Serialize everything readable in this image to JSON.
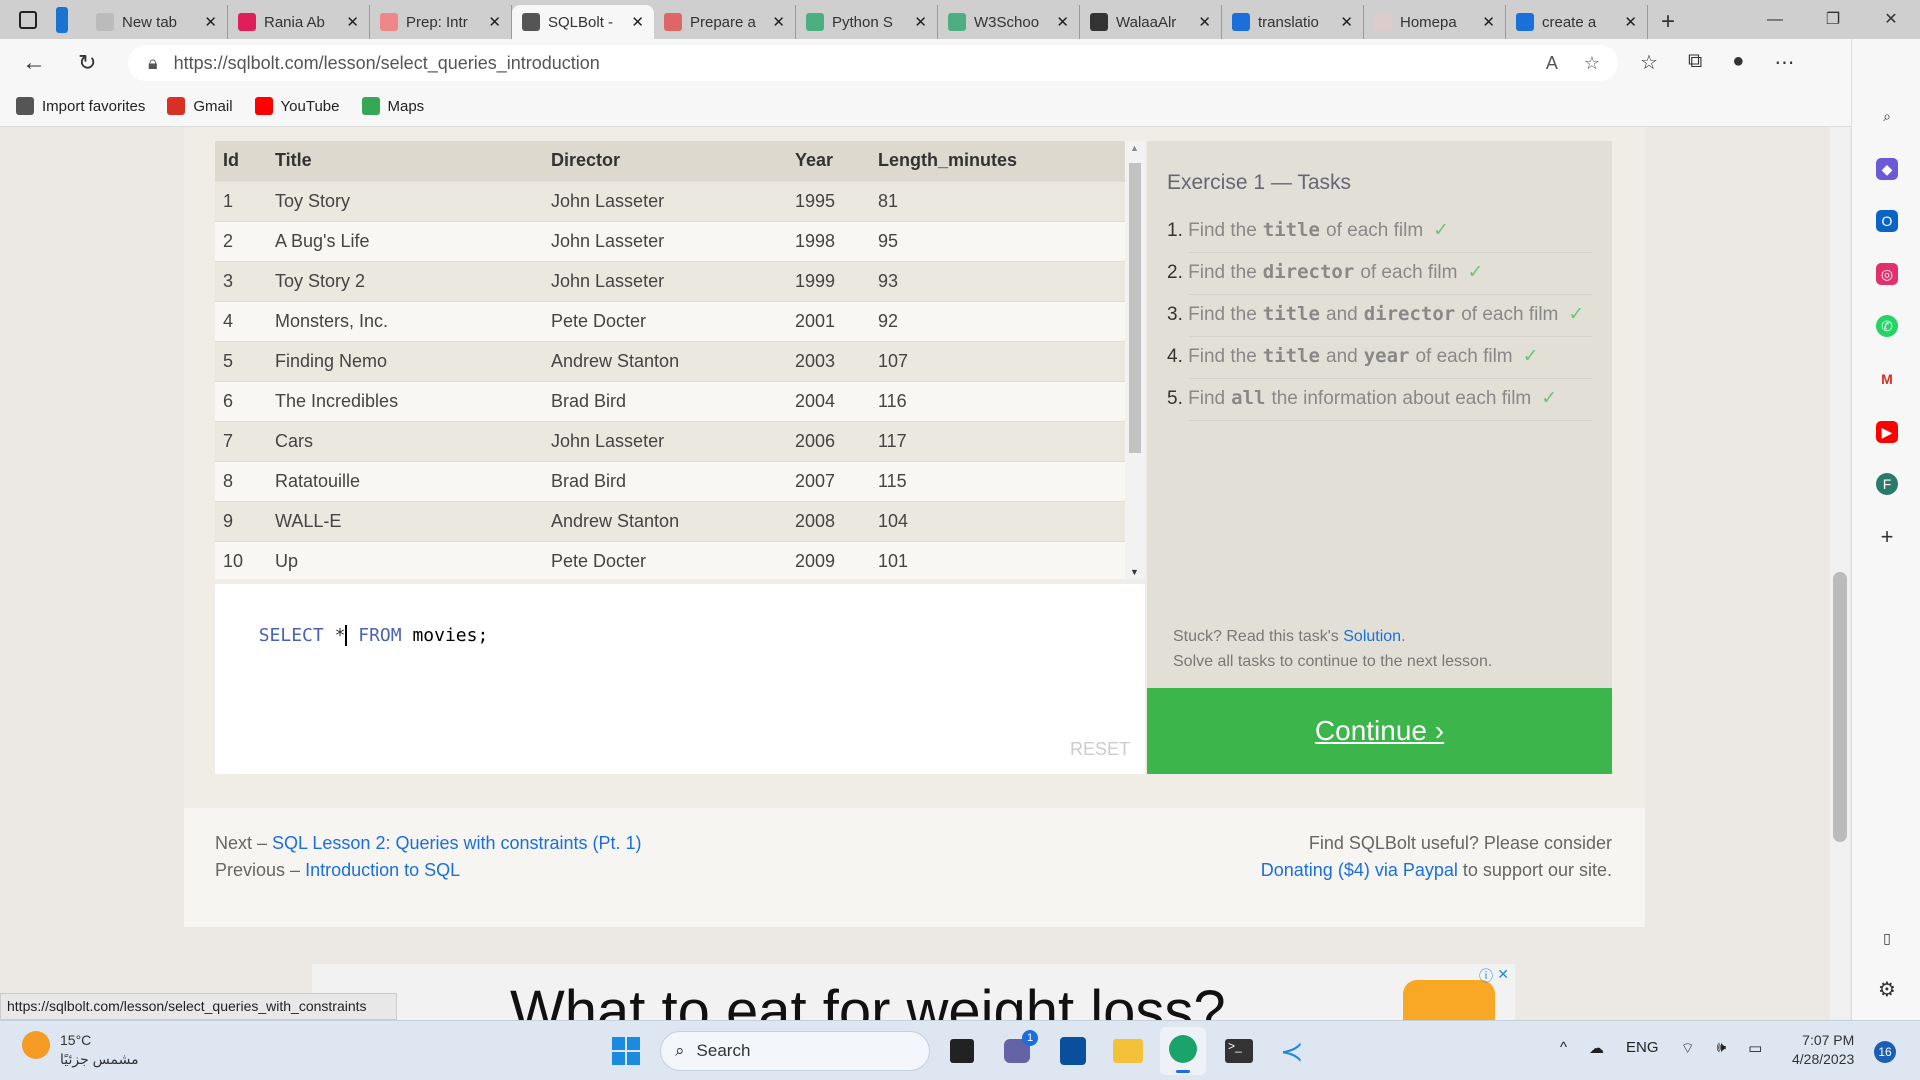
{
  "browser": {
    "tabs": [
      {
        "title": "New tab",
        "icon": "newtab-icon"
      },
      {
        "title": "Rania Ab",
        "icon": "slack-icon"
      },
      {
        "title": "Prep: Intr",
        "icon": "canvas-icon"
      },
      {
        "title": "SQLBolt -",
        "icon": "database-icon",
        "active": true
      },
      {
        "title": "Prepare a",
        "icon": "code-shield-icon"
      },
      {
        "title": "Python S",
        "icon": "w3schools-icon"
      },
      {
        "title": "W3Schoo",
        "icon": "w3schools-icon"
      },
      {
        "title": "WalaaAlr",
        "icon": "github-icon"
      },
      {
        "title": "translatio",
        "icon": "search-icon"
      },
      {
        "title": "Homepa",
        "icon": "ltuc-icon"
      },
      {
        "title": "create a",
        "icon": "search-icon"
      }
    ],
    "url": "https://sqlbolt.com/lesson/select_queries_introduction",
    "favorites": [
      {
        "label": "Import favorites"
      },
      {
        "label": "Gmail"
      },
      {
        "label": "YouTube"
      },
      {
        "label": "Maps"
      }
    ],
    "status_url": "https://sqlbolt.com/lesson/select_queries_with_constraints"
  },
  "table": {
    "columns": [
      "Id",
      "Title",
      "Director",
      "Year",
      "Length_minutes"
    ],
    "rows": [
      [
        "1",
        "Toy Story",
        "John Lasseter",
        "1995",
        "81"
      ],
      [
        "2",
        "A Bug's Life",
        "John Lasseter",
        "1998",
        "95"
      ],
      [
        "3",
        "Toy Story 2",
        "John Lasseter",
        "1999",
        "93"
      ],
      [
        "4",
        "Monsters, Inc.",
        "Pete Docter",
        "2001",
        "92"
      ],
      [
        "5",
        "Finding Nemo",
        "Andrew Stanton",
        "2003",
        "107"
      ],
      [
        "6",
        "The Incredibles",
        "Brad Bird",
        "2004",
        "116"
      ],
      [
        "7",
        "Cars",
        "John Lasseter",
        "2006",
        "117"
      ],
      [
        "8",
        "Ratatouille",
        "Brad Bird",
        "2007",
        "115"
      ],
      [
        "9",
        "WALL-E",
        "Andrew Stanton",
        "2008",
        "104"
      ],
      [
        "10",
        "Up",
        "Pete Docter",
        "2009",
        "101"
      ]
    ]
  },
  "editor": {
    "kw1": "SELECT",
    "star": "*",
    "kw2": "FROM",
    "rest": "movies;",
    "reset": "RESET"
  },
  "tasks": {
    "title": "Exercise 1 — Tasks",
    "items": [
      {
        "n": "1.",
        "a": "Find the",
        "c1": "title",
        "b": "of each film"
      },
      {
        "n": "2.",
        "a": "Find the",
        "c1": "director",
        "b": "of each film"
      },
      {
        "n": "3.",
        "a": "Find the",
        "c1": "title",
        "m": "and",
        "c2": "director",
        "b": "of each film"
      },
      {
        "n": "4.",
        "a": "Find the",
        "c1": "title",
        "m": "and",
        "c2": "year",
        "b": "of each film"
      },
      {
        "n": "5.",
        "a": "Find",
        "c1": "all",
        "b": "the information about each film"
      }
    ],
    "check": "✓",
    "stuck": "Stuck? Read this task's",
    "solution": "Solution",
    "solve_all": "Solve all tasks to continue to the next lesson.",
    "continue": "Continue ›"
  },
  "footer": {
    "next_prefix": "Next –",
    "next_link": "SQL Lesson 2: Queries with constraints (Pt. 1)",
    "prev_prefix": "Previous –",
    "prev_link": "Introduction to SQL",
    "useful": "Find SQLBolt useful? Please consider",
    "donate_link": "Donating ($4) via Paypal",
    "donate_suffix": "to support our site."
  },
  "ad": {
    "headline": "What to eat for weight loss?"
  },
  "taskbar": {
    "temp": "15°C",
    "weather": "مشمس جزئيًا",
    "search": "Search",
    "lang": "ENG",
    "time": "7:07 PM",
    "date": "4/28/2023",
    "notif": "16",
    "teams_badge": "1"
  }
}
